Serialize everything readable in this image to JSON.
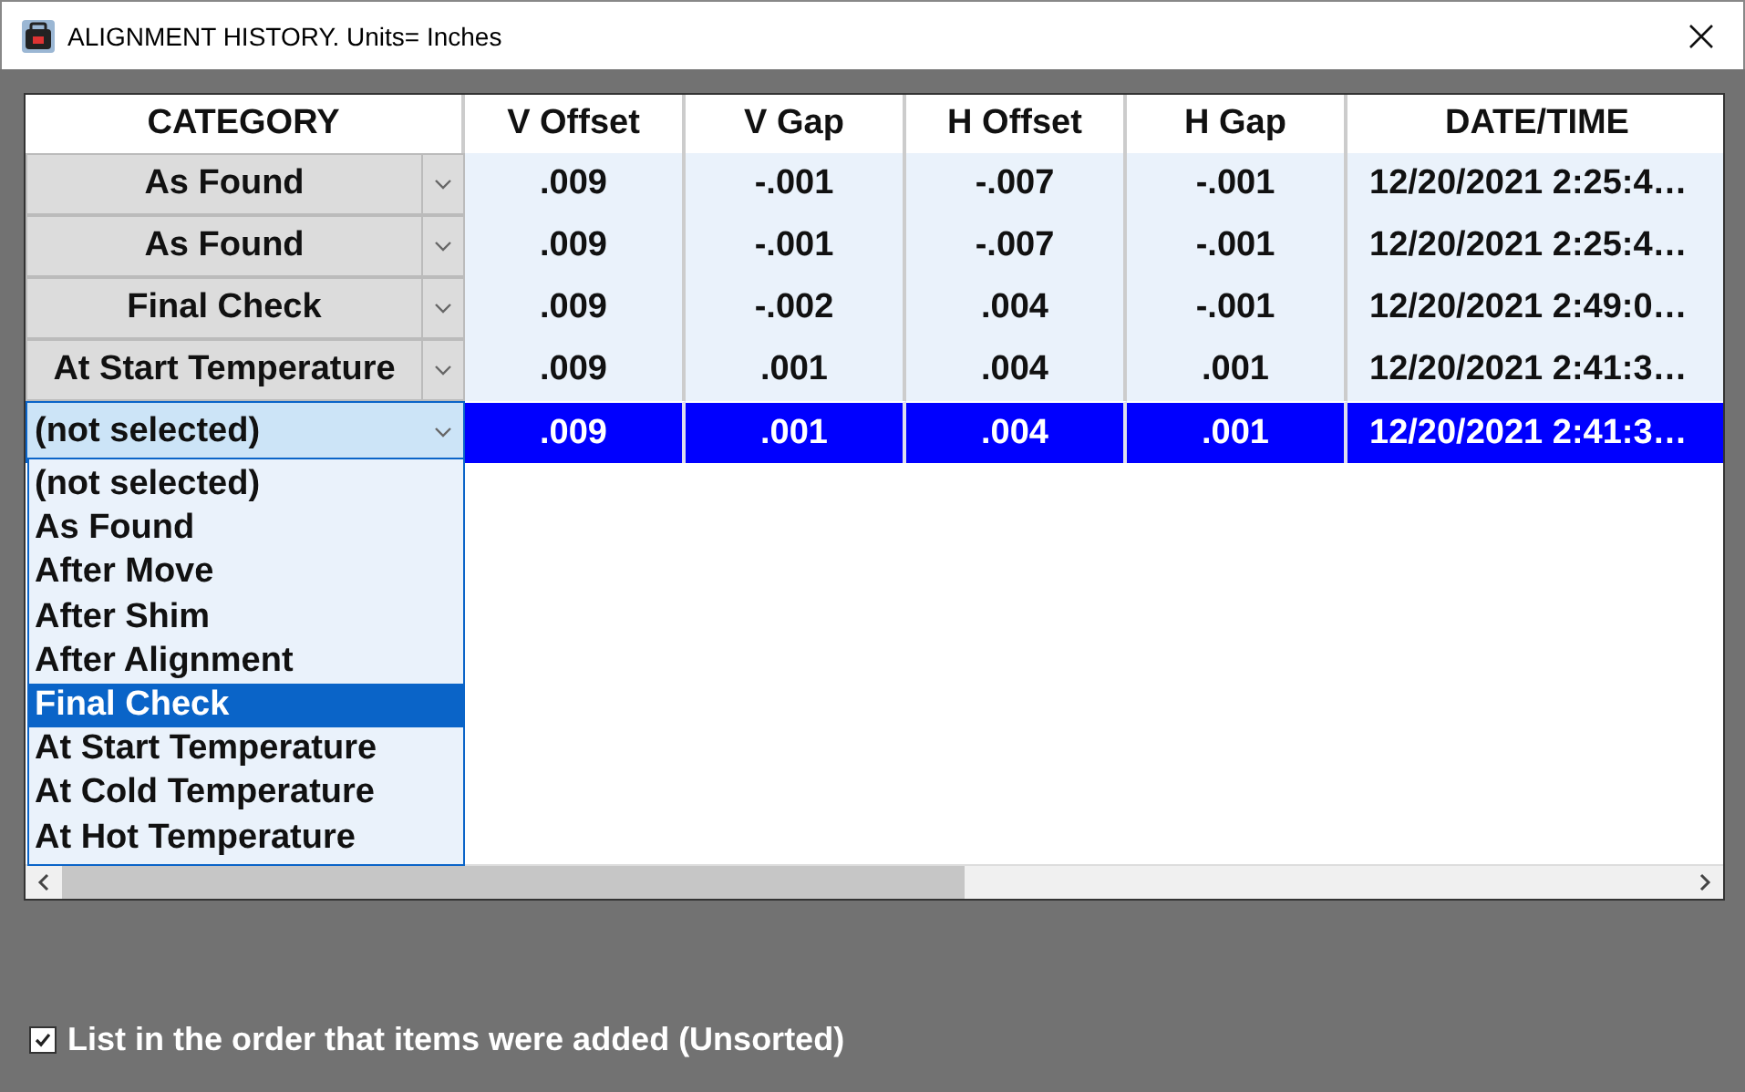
{
  "window": {
    "title": "ALIGNMENT HISTORY. Units= Inches"
  },
  "table": {
    "columns": [
      "CATEGORY",
      "V Offset",
      "V Gap",
      "H Offset",
      "H Gap",
      "DATE/TIME"
    ],
    "rows": [
      {
        "selected": false,
        "cells": [
          "As Found",
          ".009",
          "-.001",
          "-.007",
          "-.001",
          "12/20/2021 2:25:4…"
        ]
      },
      {
        "selected": false,
        "cells": [
          "As Found",
          ".009",
          "-.001",
          "-.007",
          "-.001",
          "12/20/2021 2:25:4…"
        ]
      },
      {
        "selected": false,
        "cells": [
          "Final Check",
          ".009",
          "-.002",
          ".004",
          "-.001",
          "12/20/2021 2:49:0…"
        ]
      },
      {
        "selected": false,
        "cells": [
          "At Start Temperature",
          ".009",
          ".001",
          ".004",
          ".001",
          "12/20/2021 2:41:3…"
        ]
      },
      {
        "selected": true,
        "cells": [
          "(not selected)",
          ".009",
          ".001",
          ".004",
          ".001",
          "12/20/2021 2:41:3…"
        ]
      }
    ]
  },
  "dropdown": {
    "items": [
      {
        "label": "(not selected)",
        "selected": false
      },
      {
        "label": "As Found",
        "selected": false
      },
      {
        "label": "After Move",
        "selected": false
      },
      {
        "label": "After Shim",
        "selected": false
      },
      {
        "label": "After Alignment",
        "selected": false
      },
      {
        "label": "Final Check",
        "selected": true
      },
      {
        "label": "At Start Temperature",
        "selected": false
      },
      {
        "label": "At Cold Temperature",
        "selected": false
      },
      {
        "label": "At Hot Temperature",
        "selected": false
      }
    ]
  },
  "sort_option": {
    "label": "List in the order that items were added (Unsorted)",
    "checked": true
  }
}
